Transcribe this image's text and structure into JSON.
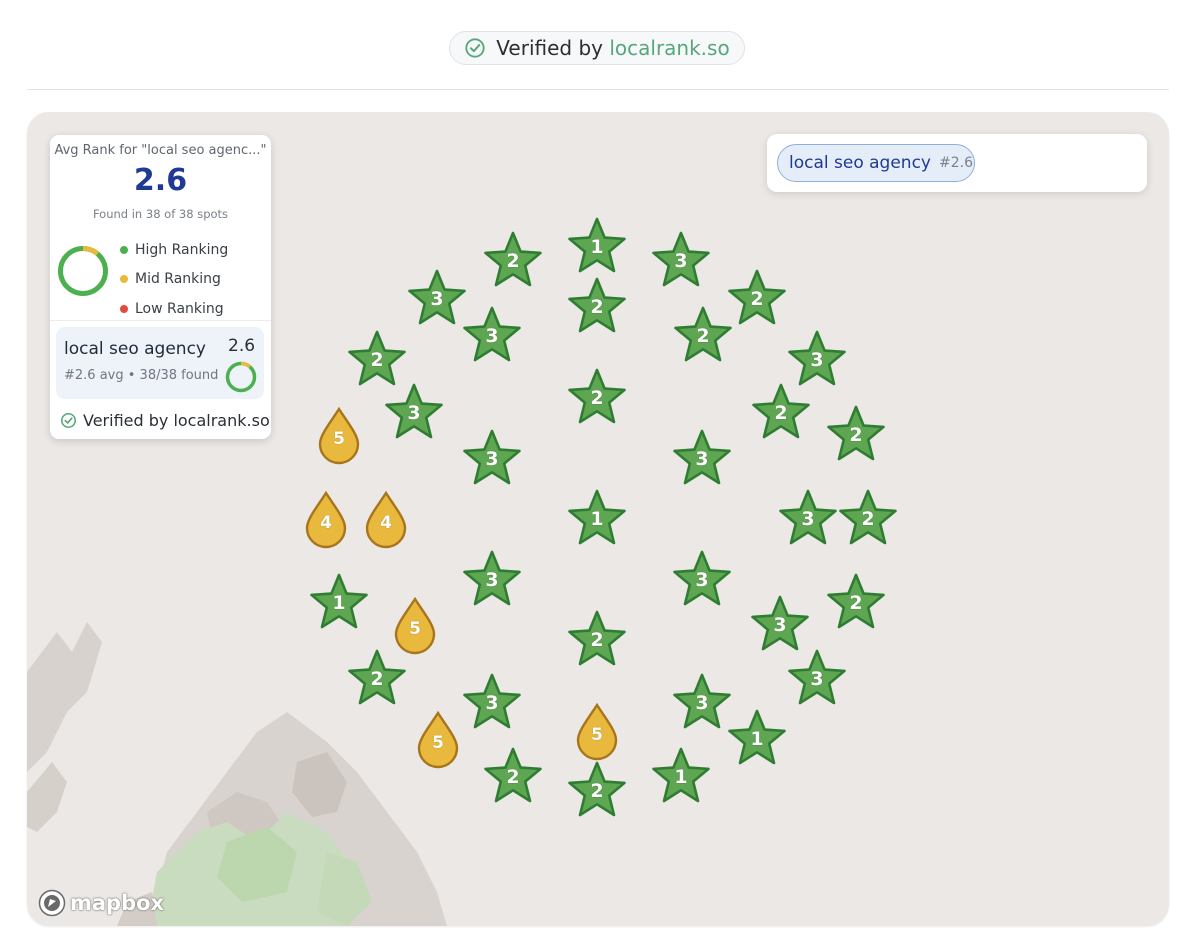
{
  "verified_banner": {
    "prefix": "Verified by",
    "brand": "localrank.so"
  },
  "panel": {
    "header": "Avg Rank for \"local seo agenc...\"",
    "avg_rank": "2.6",
    "found_text": "Found in 38 of 38 spots",
    "legend": [
      {
        "label": "High Ranking",
        "color": "#4caf50"
      },
      {
        "label": "Mid Ranking",
        "color": "#e8b93c"
      },
      {
        "label": "Low Ranking",
        "color": "#e04b3c"
      }
    ],
    "keyword_card": {
      "name": "local seo agency",
      "avg": "2.6",
      "subtitle": "#2.6 avg • 38/38 found"
    },
    "footer": "Verified by localrank.so"
  },
  "search_chip": {
    "label": "local seo agency",
    "rank": "#2.6"
  },
  "attribution": {
    "text": "mapbox"
  },
  "colors": {
    "star_fill": "#5fa653",
    "star_stroke": "#2f7d32",
    "drop_fill": "#e8b93c",
    "drop_stroke": "#a8741c",
    "brand": "#56a77a",
    "accent": "#1f3a93"
  },
  "markers": [
    {
      "rank": "1",
      "type": "star"
    },
    {
      "rank": "2",
      "type": "star"
    },
    {
      "rank": "3",
      "type": "star"
    },
    {
      "rank": "3",
      "type": "star"
    },
    {
      "rank": "2",
      "type": "star"
    },
    {
      "rank": "2",
      "type": "star"
    },
    {
      "rank": "3",
      "type": "star"
    },
    {
      "rank": "2",
      "type": "star"
    },
    {
      "rank": "2",
      "type": "star"
    },
    {
      "rank": "3",
      "type": "star"
    },
    {
      "rank": "3",
      "type": "star"
    },
    {
      "rank": "2",
      "type": "star"
    },
    {
      "rank": "2",
      "type": "star"
    },
    {
      "rank": "5",
      "type": "drop"
    },
    {
      "rank": "2",
      "type": "star"
    },
    {
      "rank": "3",
      "type": "star"
    },
    {
      "rank": "3",
      "type": "star"
    },
    {
      "rank": "4",
      "type": "drop"
    },
    {
      "rank": "4",
      "type": "drop"
    },
    {
      "rank": "1",
      "type": "star"
    },
    {
      "rank": "3",
      "type": "star"
    },
    {
      "rank": "2",
      "type": "star"
    },
    {
      "rank": "3",
      "type": "star"
    },
    {
      "rank": "1",
      "type": "star"
    },
    {
      "rank": "3",
      "type": "star"
    },
    {
      "rank": "2",
      "type": "star"
    },
    {
      "rank": "5",
      "type": "drop"
    },
    {
      "rank": "3",
      "type": "star"
    },
    {
      "rank": "2",
      "type": "star"
    },
    {
      "rank": "2",
      "type": "star"
    },
    {
      "rank": "3",
      "type": "star"
    },
    {
      "rank": "3",
      "type": "star"
    },
    {
      "rank": "3",
      "type": "star"
    },
    {
      "rank": "1",
      "type": "star"
    },
    {
      "rank": "5",
      "type": "drop"
    },
    {
      "rank": "5",
      "type": "drop"
    },
    {
      "rank": "2",
      "type": "star"
    },
    {
      "rank": "2",
      "type": "star"
    },
    {
      "rank": "1",
      "type": "star"
    }
  ]
}
